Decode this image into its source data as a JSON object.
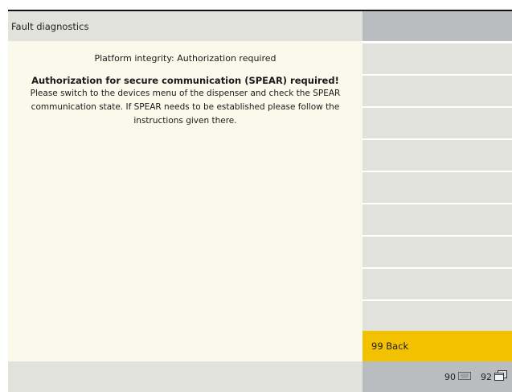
{
  "header": {
    "title": "Fault diagnostics"
  },
  "content": {
    "subtitle": "Platform integrity: Authorization required",
    "heading": "Authorization for secure communication (SPEAR) required!",
    "message": "Please switch to the devices menu of the dispenser and check the SPEAR communication state. If SPEAR needs to be established please follow the instructions given there."
  },
  "menu": {
    "back_label": "99 Back"
  },
  "footer": {
    "keys": [
      {
        "label": "90",
        "icon": "keyboard-icon"
      },
      {
        "label": "92",
        "icon": "window-icon"
      }
    ]
  },
  "colors": {
    "header_bg": "#e2e2dc",
    "content_bg": "#fbf8ec",
    "slot_bg": "#e2e2dc",
    "accent": "#f2c100",
    "panel_gray": "#b9bdbf"
  }
}
